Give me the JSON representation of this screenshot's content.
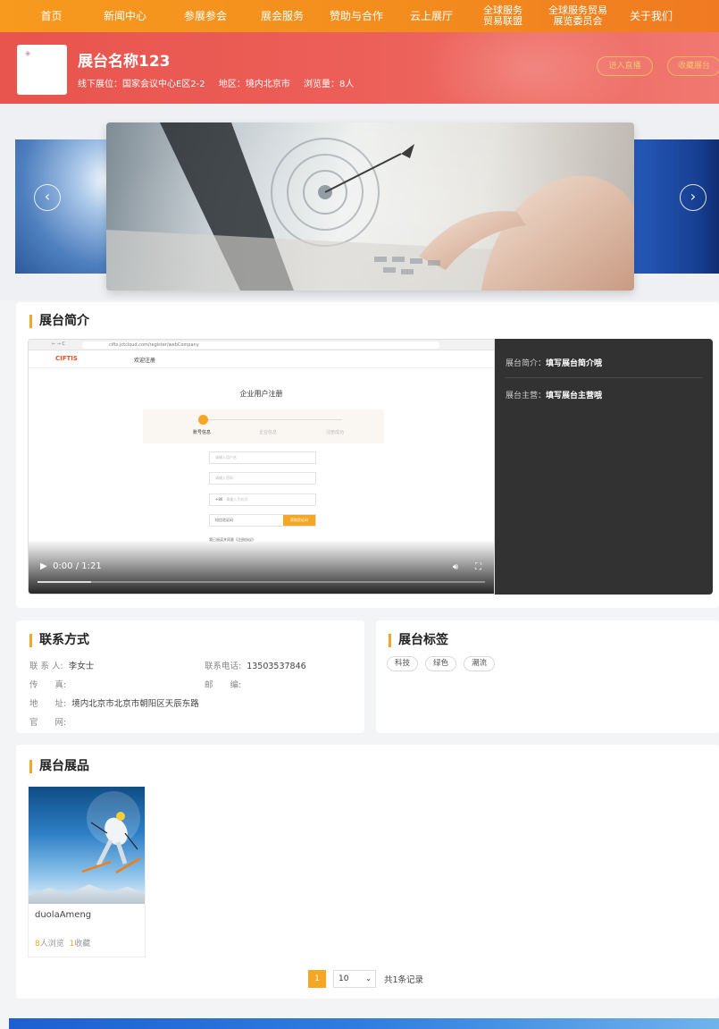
{
  "nav": {
    "items": [
      {
        "label": "首页",
        "two": false
      },
      {
        "label": "新闻中心",
        "two": false
      },
      {
        "label": "参展参会",
        "two": false
      },
      {
        "label": "展会服务",
        "two": false
      },
      {
        "label": "赞助与合作",
        "two": false
      },
      {
        "label": "云上展厅",
        "two": false
      },
      {
        "label": "全球服务\n贸易联盟",
        "two": true
      },
      {
        "label": "全球服务贸易\n展览委员会",
        "two": true
      },
      {
        "label": "关于我们",
        "two": false
      }
    ]
  },
  "header": {
    "title": "展台名称123",
    "location": "线下展位：国家会议中心E区2-2",
    "region": "地区：境内北京市",
    "views": "浏览量：8人",
    "btn_live": "进入直播",
    "btn_fav": "收藏展台"
  },
  "carousel": {
    "prev_icon": "‹",
    "next_icon": "›"
  },
  "intro": {
    "section_title": "展台简介",
    "video": {
      "time": "0:00 / 1:21",
      "progress": 0.12,
      "url": "cifts.jctcloud.com/register/webCompany",
      "site_tab": "欢迎注册",
      "page_title": "企业用户注册",
      "step1": "账号信息",
      "step2": "企业信息",
      "step3": "注册成功",
      "placeholder_1": "请输入用户名",
      "placeholder_2": "请输入密码",
      "code": "+86",
      "placeholder_3": "请输入手机号",
      "sms_label": "短信验证码",
      "sms_btn": "获取验证码",
      "agree": "我已阅读并同意《注册协议》"
    },
    "side": {
      "intro_label": "展台简介：",
      "intro_value": "填写展台简介哦",
      "main_label": "展台主营：",
      "main_value": "填写展台主营哦"
    }
  },
  "contact": {
    "section_title": "联系方式",
    "person_label": "联 系 人:",
    "person_value": "李女士",
    "phone_label": "联系电话:",
    "phone_value": "13503537846",
    "fax_label": "传　　真:",
    "fax_value": "",
    "zip_label": "邮　　编:",
    "zip_value": "",
    "addr_label": "地　　址:",
    "addr_value": "境内北京市北京市朝阳区天辰东路",
    "web_label": "官　　网:",
    "web_value": ""
  },
  "tags": {
    "section_title": "展台标签",
    "items": [
      "科技",
      "绿色",
      "潮流"
    ]
  },
  "products": {
    "section_title": "展台展品",
    "items": [
      {
        "name": "duolaAmeng",
        "views": "8",
        "views_label": "人浏览",
        "favs": "1",
        "favs_label": "收藏"
      }
    ]
  },
  "pager": {
    "current": "1",
    "size": "10",
    "total": "共1条记录"
  },
  "colors": {
    "accent": "#f5a623",
    "nav_orange": "#f38d1d",
    "header_red": "#e8544e",
    "footer_blue": "#1d5fd0"
  }
}
